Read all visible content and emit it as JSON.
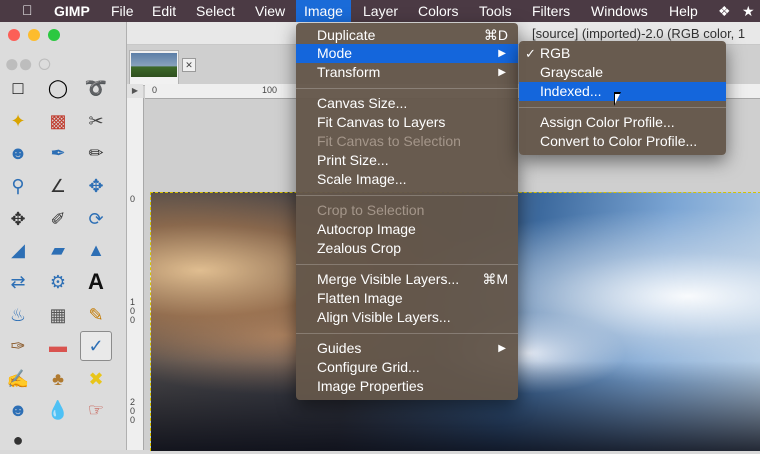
{
  "menubar": {
    "apple": "",
    "app": "GIMP",
    "items": [
      "File",
      "Edit",
      "Select",
      "View",
      "Image",
      "Layer",
      "Colors",
      "Tools",
      "Filters",
      "Windows",
      "Help"
    ],
    "active_item": "Image"
  },
  "window": {
    "title": "[source] (imported)-2.0 (RGB color, 1"
  },
  "rulers": {
    "top_ticks": [
      "0",
      "100"
    ],
    "left_ticks": [
      "0",
      "1 0 0",
      "2 0 0"
    ]
  },
  "image_menu": {
    "items": [
      {
        "label": "Duplicate",
        "shortcut": "⌘D"
      },
      {
        "label": "Mode",
        "submenu": true,
        "highlighted": true
      },
      {
        "label": "Transform",
        "submenu": true
      },
      {
        "label": "Canvas Size..."
      },
      {
        "label": "Fit Canvas to Layers"
      },
      {
        "label": "Fit Canvas to Selection",
        "disabled": true
      },
      {
        "label": "Print Size..."
      },
      {
        "label": "Scale Image..."
      },
      {
        "label": "Crop to Selection",
        "disabled": true
      },
      {
        "label": "Autocrop Image"
      },
      {
        "label": "Zealous Crop"
      },
      {
        "label": "Merge Visible Layers...",
        "shortcut": "⌘M"
      },
      {
        "label": "Flatten Image"
      },
      {
        "label": "Align Visible Layers..."
      },
      {
        "label": "Guides",
        "submenu": true
      },
      {
        "label": "Configure Grid..."
      },
      {
        "label": "Image Properties"
      }
    ]
  },
  "mode_submenu": {
    "items": [
      {
        "label": "RGB",
        "checked": true
      },
      {
        "label": "Grayscale"
      },
      {
        "label": "Indexed...",
        "highlighted": true
      },
      {
        "label": "Assign Color Profile..."
      },
      {
        "label": "Convert to Color Profile..."
      }
    ]
  },
  "toolbox": {
    "tools": [
      "rect-select-icon",
      "ellipse-select-icon",
      "free-select-icon",
      "fuzzy-select-icon",
      "color-select-icon",
      "scissors-icon",
      "foreground-select-icon",
      "paths-icon",
      "color-picker-icon",
      "zoom-icon",
      "measure-icon",
      "move-icon",
      "align-icon",
      "crop-icon",
      "rotate-icon",
      "scale-icon",
      "shear-icon",
      "perspective-icon",
      "flip-icon",
      "cage-icon",
      "text-icon",
      "bucket-fill-icon",
      "blend-icon",
      "pencil-icon",
      "paintbrush-icon",
      "eraser-icon",
      "airbrush-icon",
      "ink-icon",
      "clone-icon",
      "heal-icon",
      "perspective-clone-icon",
      "blur-icon",
      "smudge-icon",
      "dodge-burn-icon"
    ],
    "selected_tool": "airbrush-icon"
  },
  "colors": {
    "menubar_bg": "#4b3a44",
    "menu_bg": "#64564a",
    "highlight": "#1466dc"
  }
}
